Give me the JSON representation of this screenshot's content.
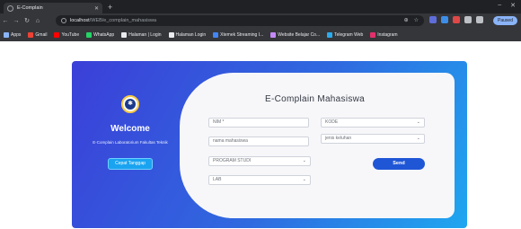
{
  "browser": {
    "tab_title": "E-Complain",
    "url_host": "localhost",
    "url_path": "/WEB/e_complain_mahasiswa",
    "profile_label": "Paused",
    "bookmarks": [
      "Apps",
      "Gmail",
      "YouTube",
      "WhatsApp",
      "Halaman | Login",
      "Halaman Login",
      "Xtemek Streaming I...",
      "Website Belajar Co...",
      "Telegram Web",
      "Instagram"
    ]
  },
  "welcome": {
    "title": "Welcome",
    "subtitle": "E-Complain Laboratorium Fakultas Teknik",
    "button": "Cepat Tanggap"
  },
  "form": {
    "title": "E-Complain Mahasiswa",
    "nim_placeholder": "NIM *",
    "nama_placeholder": "nama mahasiswa",
    "prodi_selected": "PROGRAM STUDI",
    "lab_selected": "LAB",
    "kode_selected": "KODE",
    "jenis_selected": "jenis keluhan",
    "send_label": "Send"
  }
}
